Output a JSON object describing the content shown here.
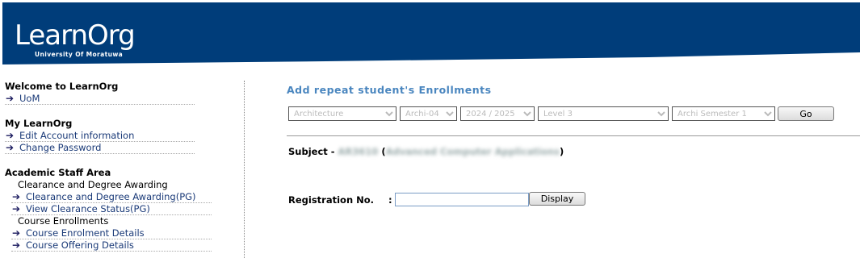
{
  "header": {
    "logo_title": "LearnOrg",
    "logo_subtitle": "University Of Moratuwa",
    "bg_color": "#003d7a"
  },
  "sidebar": {
    "sections": [
      {
        "title": "Welcome to LearnOrg",
        "items": [
          "UoM"
        ]
      },
      {
        "title": "My LearnOrg",
        "items": [
          "Edit Account information",
          "Change Password"
        ]
      },
      {
        "title": "Academic Staff Area",
        "groups": [
          {
            "label": "Clearance and Degree Awarding",
            "items": [
              "Clearance and Degree Awarding(PG)",
              "View Clearance Status(PG)"
            ]
          },
          {
            "label": "Course Enrollments",
            "items": [
              "Course Enrolment Details",
              "Course Offering Details"
            ]
          }
        ]
      }
    ]
  },
  "main": {
    "title": "Add repeat student's Enrollments",
    "filters": {
      "faculty": "Architecture",
      "department": "Archi-04",
      "academic_year": "2024 / 2025",
      "level": "Level 3",
      "semester": "Archi Semester 1"
    },
    "go_label": "Go",
    "subject_label": "Subject - ",
    "subject_code": "AR3610",
    "subject_name": "Advanced Computer Applications",
    "registration_label": "Registration No.",
    "registration_colon": ":",
    "registration_value": "",
    "display_label": "Display"
  },
  "colors": {
    "accent": "#4a86bf",
    "link": "#1a3a78"
  }
}
